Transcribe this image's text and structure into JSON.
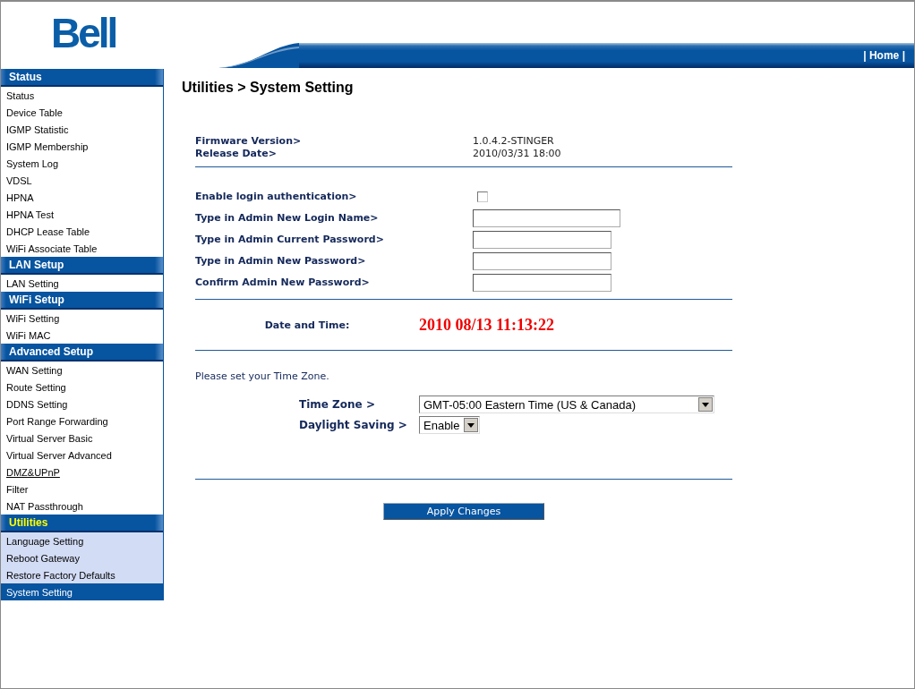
{
  "header": {
    "logo": "Bell",
    "home_link": "| Home |"
  },
  "sidebar": {
    "sections": [
      {
        "title": "Status",
        "active": false,
        "items": [
          {
            "label": "Status",
            "selected": false,
            "hovered": false
          },
          {
            "label": "Device Table",
            "selected": false,
            "hovered": false
          },
          {
            "label": "IGMP Statistic",
            "selected": false,
            "hovered": false
          },
          {
            "label": "IGMP Membership",
            "selected": false,
            "hovered": false
          },
          {
            "label": "System Log",
            "selected": false,
            "hovered": false
          },
          {
            "label": "VDSL",
            "selected": false,
            "hovered": false
          },
          {
            "label": "HPNA",
            "selected": false,
            "hovered": false
          },
          {
            "label": "HPNA Test",
            "selected": false,
            "hovered": false
          },
          {
            "label": "DHCP Lease Table",
            "selected": false,
            "hovered": false
          },
          {
            "label": "WiFi Associate Table",
            "selected": false,
            "hovered": false
          }
        ]
      },
      {
        "title": "LAN Setup",
        "active": false,
        "items": [
          {
            "label": "LAN Setting",
            "selected": false,
            "hovered": false
          }
        ]
      },
      {
        "title": "WiFi Setup",
        "active": false,
        "items": [
          {
            "label": "WiFi Setting",
            "selected": false,
            "hovered": false
          },
          {
            "label": "WiFi MAC",
            "selected": false,
            "hovered": false
          }
        ]
      },
      {
        "title": "Advanced Setup",
        "active": false,
        "items": [
          {
            "label": "WAN Setting",
            "selected": false,
            "hovered": false
          },
          {
            "label": "Route Setting",
            "selected": false,
            "hovered": false
          },
          {
            "label": "DDNS Setting",
            "selected": false,
            "hovered": false
          },
          {
            "label": "Port Range Forwarding",
            "selected": false,
            "hovered": false
          },
          {
            "label": "Virtual Server Basic",
            "selected": false,
            "hovered": false
          },
          {
            "label": "Virtual Server Advanced",
            "selected": false,
            "hovered": false
          },
          {
            "label": "DMZ&UPnP",
            "selected": false,
            "hovered": true
          },
          {
            "label": "Filter",
            "selected": false,
            "hovered": false
          },
          {
            "label": "NAT Passthrough",
            "selected": false,
            "hovered": false
          }
        ]
      },
      {
        "title": "Utilities",
        "active": true,
        "items": [
          {
            "label": "Language Setting",
            "selected": false,
            "hovered": false
          },
          {
            "label": "Reboot Gateway",
            "selected": false,
            "hovered": false
          },
          {
            "label": "Restore Factory Defaults",
            "selected": false,
            "hovered": false
          },
          {
            "label": "System Setting",
            "selected": true,
            "hovered": false
          }
        ]
      }
    ]
  },
  "page_title": "Utilities > System Setting",
  "firmware": [
    {
      "label": "Firmware Version>",
      "value": "1.0.4.2-STINGER"
    },
    {
      "label": "Release Date>",
      "value": "2010/03/31 18:00"
    }
  ],
  "login": {
    "label": "Enable login authentication>",
    "enabled": false
  },
  "fields": [
    {
      "label": "Type in Admin New Login Name>",
      "kind": "text"
    },
    {
      "label": "Type in Admin Current Password>",
      "kind": "password"
    },
    {
      "label": "Type in Admin New Password>",
      "kind": "password"
    },
    {
      "label": "Confirm Admin New Password>",
      "kind": "password"
    }
  ],
  "date_time": {
    "label": "Date and Time:",
    "value": "2010 08/13 11:13:22"
  },
  "time_zone_note": "Please set your Time Zone.",
  "selects": [
    {
      "label": "Time Zone >",
      "value": "GMT-05:00 Eastern Time (US & Canada)",
      "kind": "wide"
    },
    {
      "label": "Daylight Saving >",
      "value": "Enable",
      "kind": "narrow"
    }
  ],
  "apply_button": "Apply Changes"
}
